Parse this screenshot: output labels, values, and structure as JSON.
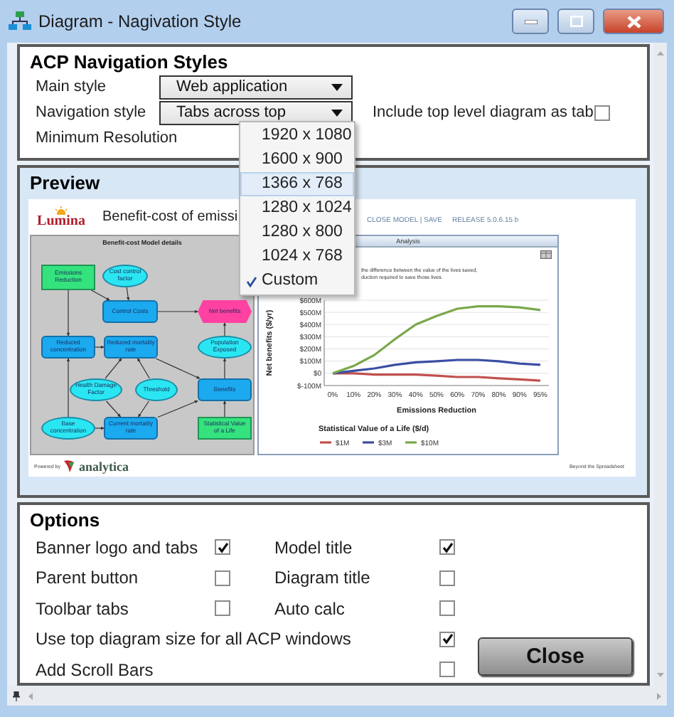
{
  "window": {
    "title": "Diagram - Nagivation Style"
  },
  "navigation": {
    "title": "ACP Navigation Styles",
    "fields": [
      {
        "label": "Main style",
        "value": "Web application"
      },
      {
        "label": "Navigation style",
        "value": "Tabs across top"
      },
      {
        "label": "Minimum Resolution"
      }
    ],
    "include_top_level": {
      "label": "Include top level diagram as tab",
      "checked": false
    }
  },
  "resolution_menu": [
    {
      "label": "1920 x 1080",
      "selected": false,
      "hovered": false
    },
    {
      "label": "1600 x 900",
      "selected": false,
      "hovered": false
    },
    {
      "label": "1366 x 768",
      "selected": false,
      "hovered": true
    },
    {
      "label": "1280 x 1024",
      "selected": false,
      "hovered": false
    },
    {
      "label": "1280 x 800",
      "selected": false,
      "hovered": false
    },
    {
      "label": "1024 x 768",
      "selected": false,
      "hovered": false
    },
    {
      "label": "Custom",
      "selected": true,
      "hovered": false
    }
  ],
  "preview": {
    "title": "Preview",
    "logo": "Lumina",
    "heading": "Benefit-cost of emissi",
    "links": "CLOSE MODEL | SAVE",
    "release": "RELEASE 5.0.6.15 b",
    "diagram": {
      "title": "Benefit-cost Model details",
      "nodes": [
        {
          "label": "Emissions Reduction",
          "kind": "decision"
        },
        {
          "label": "Cost control factor",
          "kind": "chance"
        },
        {
          "label": "Control Costs",
          "kind": "variable"
        },
        {
          "label": "Net benefits",
          "kind": "objective"
        },
        {
          "label": "Reduced concentration",
          "kind": "variable"
        },
        {
          "label": "Reduced mortality rate",
          "kind": "variable"
        },
        {
          "label": "Population Exposed",
          "kind": "chance"
        },
        {
          "label": "Health Damage Factor",
          "kind": "chance"
        },
        {
          "label": "Threshold",
          "kind": "chance"
        },
        {
          "label": "Benefits",
          "kind": "variable"
        },
        {
          "label": "Base concentration",
          "kind": "chance"
        },
        {
          "label": "Current mortality rate",
          "kind": "variable"
        },
        {
          "label": "Statistical Value of a Life",
          "kind": "decision"
        }
      ]
    },
    "analysis": {
      "tab": "Analysis",
      "description": [
        "the difference between the value of the lives saved,",
        "duction required to save those lives."
      ],
      "chart_data": {
        "type": "line",
        "xlabel": "Emissions Reduction",
        "ylabel": "Net benefits ($/yr)",
        "grid": true,
        "legend": {
          "title": "Statistical Value of a Life ($/d)"
        },
        "categories": [
          "0%",
          "10%",
          "20%",
          "30%",
          "40%",
          "50%",
          "60%",
          "70%",
          "80%",
          "90%",
          "95%"
        ],
        "series": [
          {
            "name": "$1M",
            "color": "#c0504d",
            "values": [
              0,
              0,
              -10,
              -10,
              -10,
              -20,
              -30,
              -30,
              -40,
              -50,
              -60
            ]
          },
          {
            "name": "$3M",
            "color": "#3b4ea3",
            "values": [
              0,
              20,
              40,
              70,
              90,
              100,
              110,
              110,
              100,
              80,
              70
            ]
          },
          {
            "name": "$10M",
            "color": "#7aa84a",
            "values": [
              0,
              60,
              150,
              280,
              400,
              470,
              530,
              550,
              550,
              540,
              520
            ]
          }
        ],
        "ylim": [
          -100,
          600
        ],
        "yticks": [
          {
            "value": -100,
            "label": "$-100M"
          },
          {
            "value": 0,
            "label": "$0"
          },
          {
            "value": 100,
            "label": "$100M"
          },
          {
            "value": 200,
            "label": "$200M"
          },
          {
            "value": 300,
            "label": "$300M"
          },
          {
            "value": 400,
            "label": "$400M"
          },
          {
            "value": 500,
            "label": "$500M"
          },
          {
            "value": 600,
            "label": "$600M"
          }
        ]
      }
    },
    "footer": {
      "powered_by": "Powered by",
      "brand": "analytica",
      "tagline": "Beyond the Spreadsheet"
    }
  },
  "options": {
    "title": "Options",
    "items": [
      {
        "label": "Banner logo and tabs",
        "checked": true,
        "kind": "pair"
      },
      {
        "label": "Model title",
        "checked": true,
        "kind": "pair"
      },
      {
        "label": "Parent button",
        "checked": false,
        "kind": "pair"
      },
      {
        "label": "Diagram title",
        "checked": false,
        "kind": "pair"
      },
      {
        "label": "Toolbar tabs",
        "checked": false,
        "kind": "pair"
      },
      {
        "label": "Auto calc",
        "checked": false,
        "kind": "pair"
      },
      {
        "label": "Use top diagram size for all ACP windows",
        "checked": true,
        "kind": "wide"
      },
      {
        "label": "Add Scroll Bars",
        "checked": false,
        "kind": "wide"
      }
    ],
    "close": "Close"
  }
}
